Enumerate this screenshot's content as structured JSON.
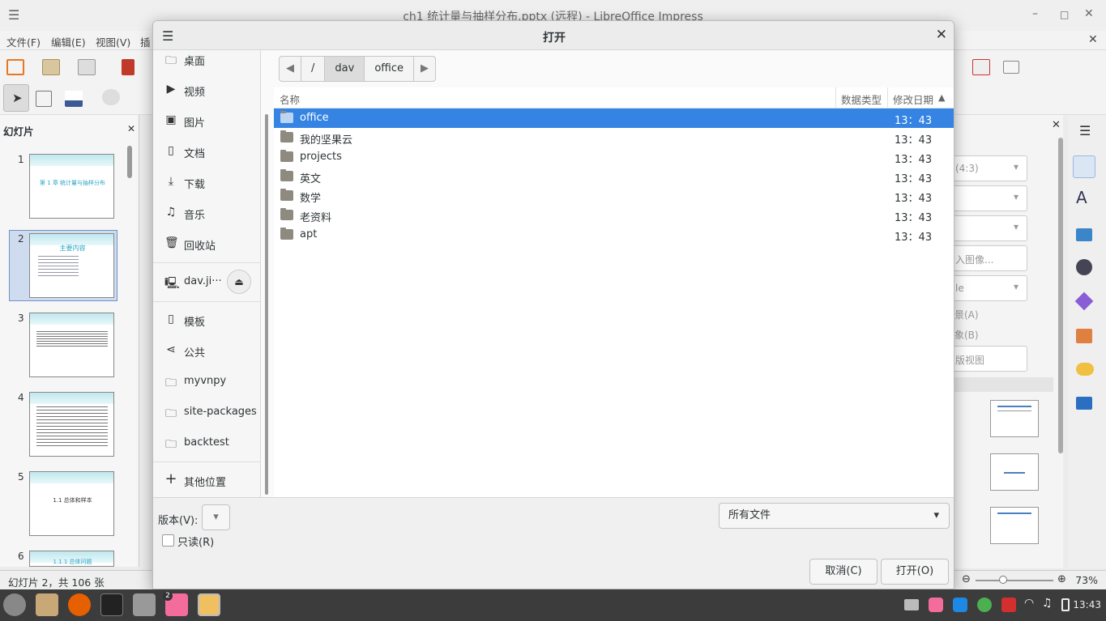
{
  "window": {
    "title": "ch1 统计量与抽样分布.pptx (远程) - LibreOffice Impress",
    "minimize": "–",
    "maximize": "□",
    "close": "✕"
  },
  "menubar": {
    "items": [
      "文件(F)",
      "编辑(E)",
      "视图(V)",
      "插"
    ]
  },
  "slides_panel": {
    "title": "幻灯片",
    "close": "✕",
    "slides": [
      {
        "num": "1",
        "text": "第 1 章   统计量与抽样分布"
      },
      {
        "num": "2",
        "text": "主要内容"
      },
      {
        "num": "3",
        "text": ""
      },
      {
        "num": "4",
        "text": ""
      },
      {
        "num": "5",
        "text": "1.1   总体和样本"
      },
      {
        "num": "6",
        "text": "1.1.1  总体问题"
      }
    ]
  },
  "statusbar": {
    "text": "幻灯片 2，共 106 张",
    "zoom": "73%"
  },
  "right_panel": {
    "fields": [
      "(4:3)",
      "",
      "",
      "入图像...",
      "le"
    ],
    "labels": [
      "景(A)",
      "象(B)",
      "版视图"
    ]
  },
  "dialog": {
    "title": "打开",
    "places": [
      {
        "label": "桌面",
        "icon": "folder-icon"
      },
      {
        "label": "视频",
        "icon": "video-icon"
      },
      {
        "label": "图片",
        "icon": "picture-icon"
      },
      {
        "label": "文档",
        "icon": "document-icon"
      },
      {
        "label": "下载",
        "icon": "download-icon"
      },
      {
        "label": "音乐",
        "icon": "music-icon"
      },
      {
        "label": "回收站",
        "icon": "trash-icon"
      },
      {
        "label": "dav.ji···",
        "icon": "network-drive-icon"
      },
      {
        "label": "模板",
        "icon": "template-icon"
      },
      {
        "label": "公共",
        "icon": "share-icon"
      },
      {
        "label": "myvnpy",
        "icon": "folder-icon"
      },
      {
        "label": "site-packages",
        "icon": "folder-icon"
      },
      {
        "label": "backtest",
        "icon": "folder-icon"
      },
      {
        "label": "其他位置",
        "icon": "plus-icon"
      }
    ],
    "path": [
      "/",
      "dav",
      "office"
    ],
    "columns": {
      "name": "名称",
      "type": "数据类型",
      "modified": "修改日期"
    },
    "files": [
      {
        "name": "office",
        "modified": "13：43"
      },
      {
        "name": "我的坚果云",
        "modified": "13：43"
      },
      {
        "name": "projects",
        "modified": "13：43"
      },
      {
        "name": "英文",
        "modified": "13：43"
      },
      {
        "name": "数学",
        "modified": "13：43"
      },
      {
        "name": "老资料",
        "modified": "13：43"
      },
      {
        "name": "apt",
        "modified": "13：43"
      }
    ],
    "version_label": "版本(V):",
    "readonly_label": "只读(R)",
    "filter": "所有文件",
    "cancel": "取消(C)",
    "open": "打开(O)"
  },
  "taskbar": {
    "clock": "13:43",
    "badge": "2"
  }
}
